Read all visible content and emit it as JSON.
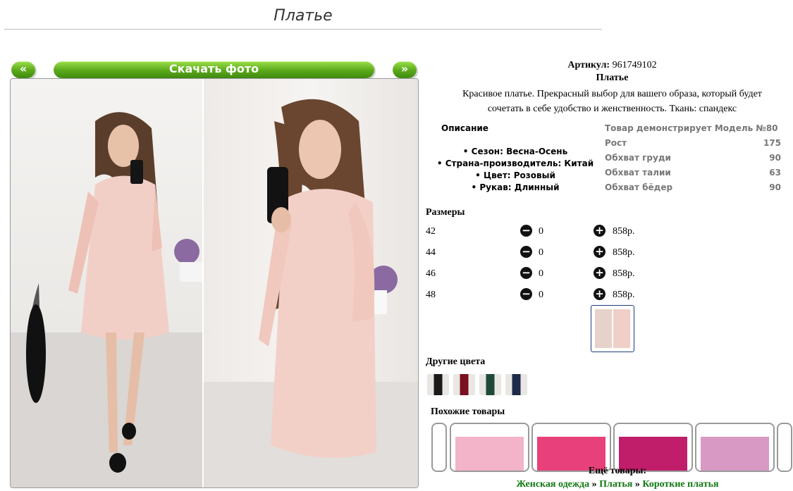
{
  "page": {
    "title": "Платье"
  },
  "gallery": {
    "prev_label": "«",
    "next_label": "»",
    "download_label": "Скачать фото"
  },
  "product": {
    "article_label": "Артикул:",
    "article_value": "961749102",
    "name": "Платье",
    "description_line1": "Красивое платье. Прекрасный выбор для вашего образа, который будет",
    "description_line2": "сочетать в себе удобство и женственность. Ткань: спандекс"
  },
  "specs": {
    "heading": "Описание",
    "items": [
      "• Сезон: Весна-Осень",
      "• Страна-производитель: Китай",
      "• Цвет: Розовый",
      "• Рукав: Длинный"
    ]
  },
  "model": {
    "heading": "Товар демонстрирует Модель №80",
    "rows": [
      {
        "label": "Рост",
        "value": "175"
      },
      {
        "label": "Обхват груди",
        "value": "90"
      },
      {
        "label": "Обхват талии",
        "value": "63"
      },
      {
        "label": "Обхват бёдер",
        "value": "90"
      }
    ]
  },
  "sizes": {
    "heading": "Размеры",
    "minus_icon": "⊖",
    "plus_icon": "⊕",
    "rows": [
      {
        "size": "42",
        "qty": "0",
        "price": "858р."
      },
      {
        "size": "44",
        "qty": "0",
        "price": "858р."
      },
      {
        "size": "46",
        "qty": "0",
        "price": "858р."
      },
      {
        "size": "48",
        "qty": "0",
        "price": "858р."
      }
    ]
  },
  "other_colors": {
    "heading": "Другие цвета",
    "swatch_colors": [
      "#1a1a1a",
      "#7a1020",
      "#1f4a3a",
      "#1e2a4a"
    ]
  },
  "similar": {
    "heading": "Похожие товары"
  },
  "more": {
    "heading": "Ещё товары:",
    "crumb1": "Женская одежда",
    "sep1": "»",
    "crumb2": "Платья",
    "sep2": "»",
    "crumb3": "Короткие платья"
  }
}
